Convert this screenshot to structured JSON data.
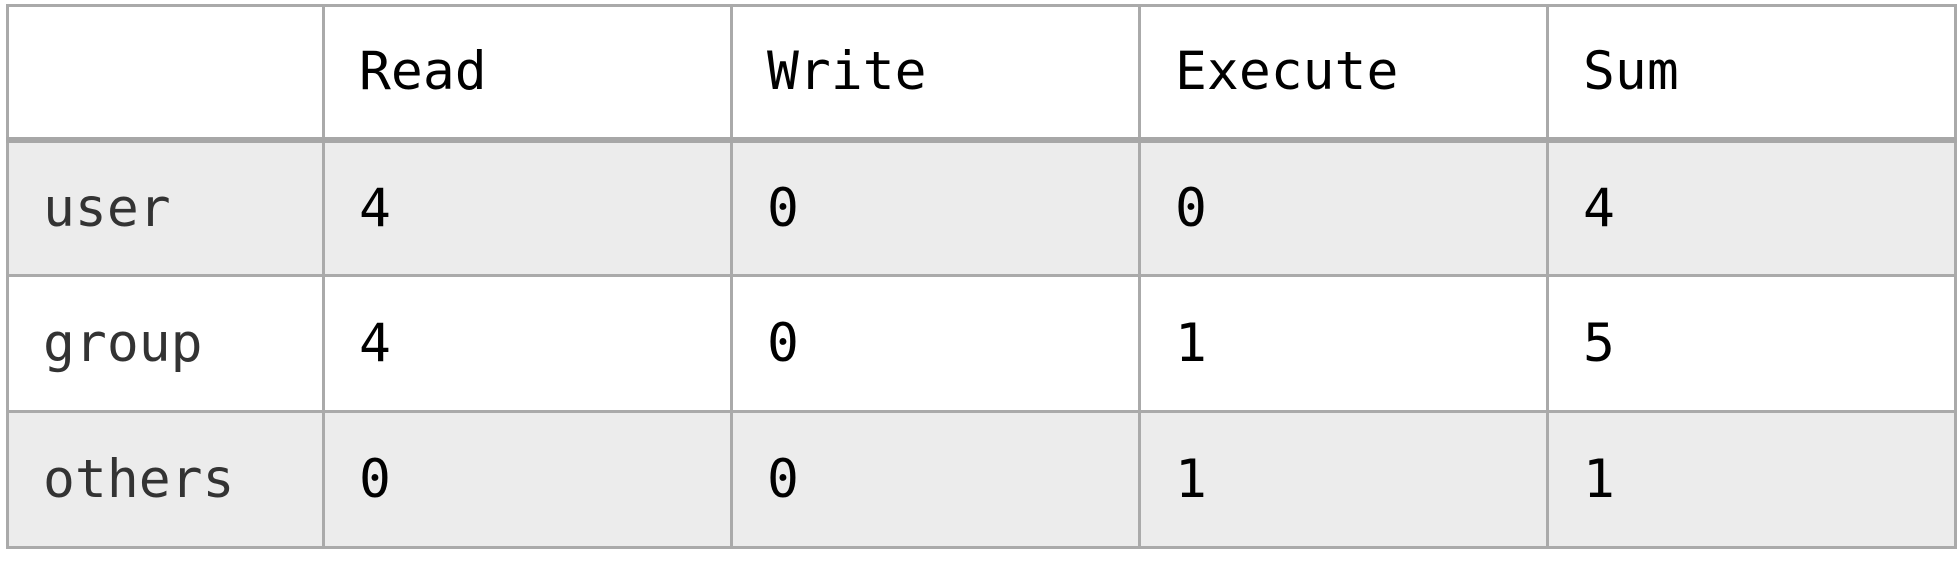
{
  "table": {
    "corner_label": "",
    "columns": [
      "Read",
      "Write",
      "Execute",
      "Sum"
    ],
    "rows": [
      {
        "label": "user",
        "cells": [
          "4",
          "0",
          "0",
          "4"
        ]
      },
      {
        "label": "group",
        "cells": [
          "4",
          "0",
          "1",
          "5"
        ]
      },
      {
        "label": "others",
        "cells": [
          "0",
          "0",
          "1",
          "1"
        ]
      }
    ]
  },
  "colors": {
    "border": "#aaaaaa",
    "shaded_row": "#ececec",
    "text": "#000000"
  }
}
